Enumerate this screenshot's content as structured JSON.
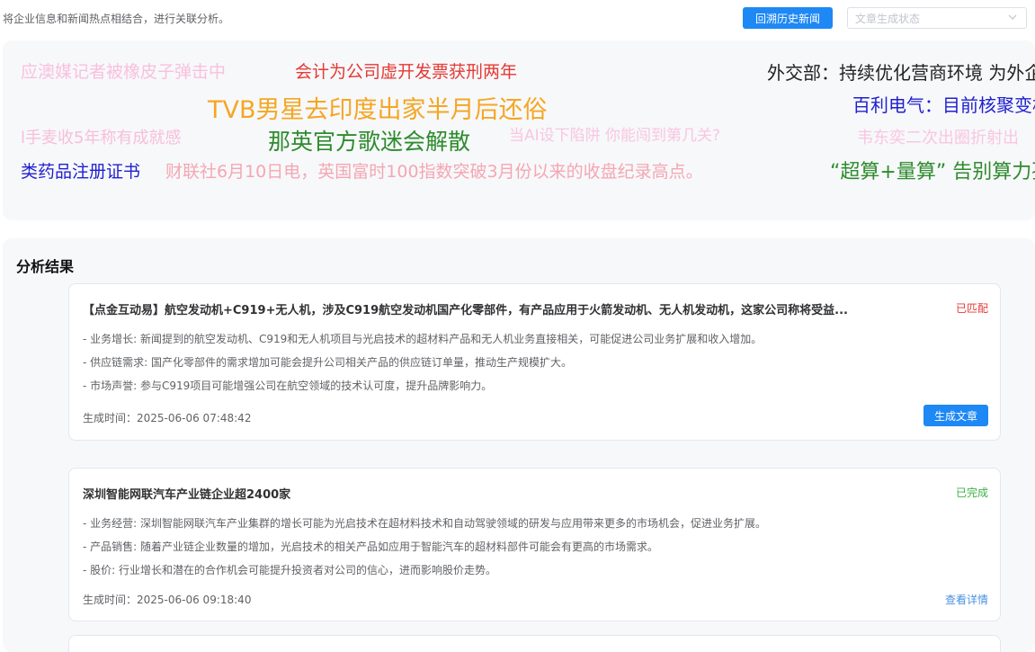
{
  "header": {
    "intro": "将企业信息和新闻热点相结合，进行关联分析。",
    "review_button": "回溯历史新闻",
    "status_select": {
      "placeholder": "文章生成状态"
    }
  },
  "word_cloud": {
    "words": [
      {
        "text": "应澳媒记者被橡皮子弹击中",
        "color": "#f9c0e0"
      },
      {
        "text": "会计为公司虚开发票获刑两年",
        "color": "#e53935"
      },
      {
        "text": "外交部：持续优化营商环境 为外企",
        "color": "#222222"
      },
      {
        "text": "TVB男星去印度出家半月后还俗",
        "color": "#f5a623"
      },
      {
        "text": "百利电气：目前核聚变相",
        "color": "#1f1fcf"
      },
      {
        "text": "l手麦收5年称有成就感",
        "color": "#f7bfd9"
      },
      {
        "text": "那英官方歌迷会解散",
        "color": "#2e8b2e"
      },
      {
        "text": "当AI设下陷阱 你能闯到第几关?",
        "color": "#f9c6e2"
      },
      {
        "text": "韦东奕二次出圈折射出",
        "color": "#f9c6e2"
      },
      {
        "text": "类药品注册证书",
        "color": "#1f1fcf"
      },
      {
        "text": "财联社6月10日电，英国富时100指数突破3月份以来的收盘纪录高点。",
        "color": "#f4a7b3"
      },
      {
        "text": "“超算+量算” 告别算力孤",
        "color": "#2e8b2e"
      }
    ]
  },
  "results": {
    "title": "分析结果",
    "cards": [
      {
        "title": "【点金互动易】航空发动机+C919+无人机，涉及C919航空发动机国产化零部件，有产品应用于火箭发动机、无人机发动机，这家公司称将受益...",
        "status": "已匹配",
        "status_color": "#e53935",
        "lines": [
          "- 业务增长: 新闻提到的航空发动机、C919和无人机项目与光启技术的超材料产品和无人机业务直接相关，可能促进公司业务扩展和收入增加。",
          "- 供应链需求: 国产化零部件的需求增加可能会提升公司相关产品的供应链订单量，推动生产规模扩大。",
          "- 市场声誉: 参与C919项目可能增强公司在航空领域的技术认可度，提升品牌影响力。"
        ],
        "time": "生成时间：2025-06-06 07:48:42",
        "action": "生成文章"
      },
      {
        "title": "深圳智能网联汽车产业链企业超2400家",
        "status": "已完成",
        "status_color": "#3cb043",
        "lines": [
          "- 业务经营: 深圳智能网联汽车产业集群的增长可能为光启技术在超材料技术和自动驾驶领域的研发与应用带来更多的市场机会，促进业务扩展。",
          "- 产品销售: 随着产业链企业数量的增加，光启技术的相关产品如应用于智能汽车的超材料部件可能会有更高的市场需求。",
          "- 股价: 行业增长和潜在的合作机会可能提升投资者对公司的信心，进而影响股价走势。"
        ],
        "time": "生成时间：2025-06-06 09:18:40",
        "action": "查看详情"
      }
    ]
  }
}
